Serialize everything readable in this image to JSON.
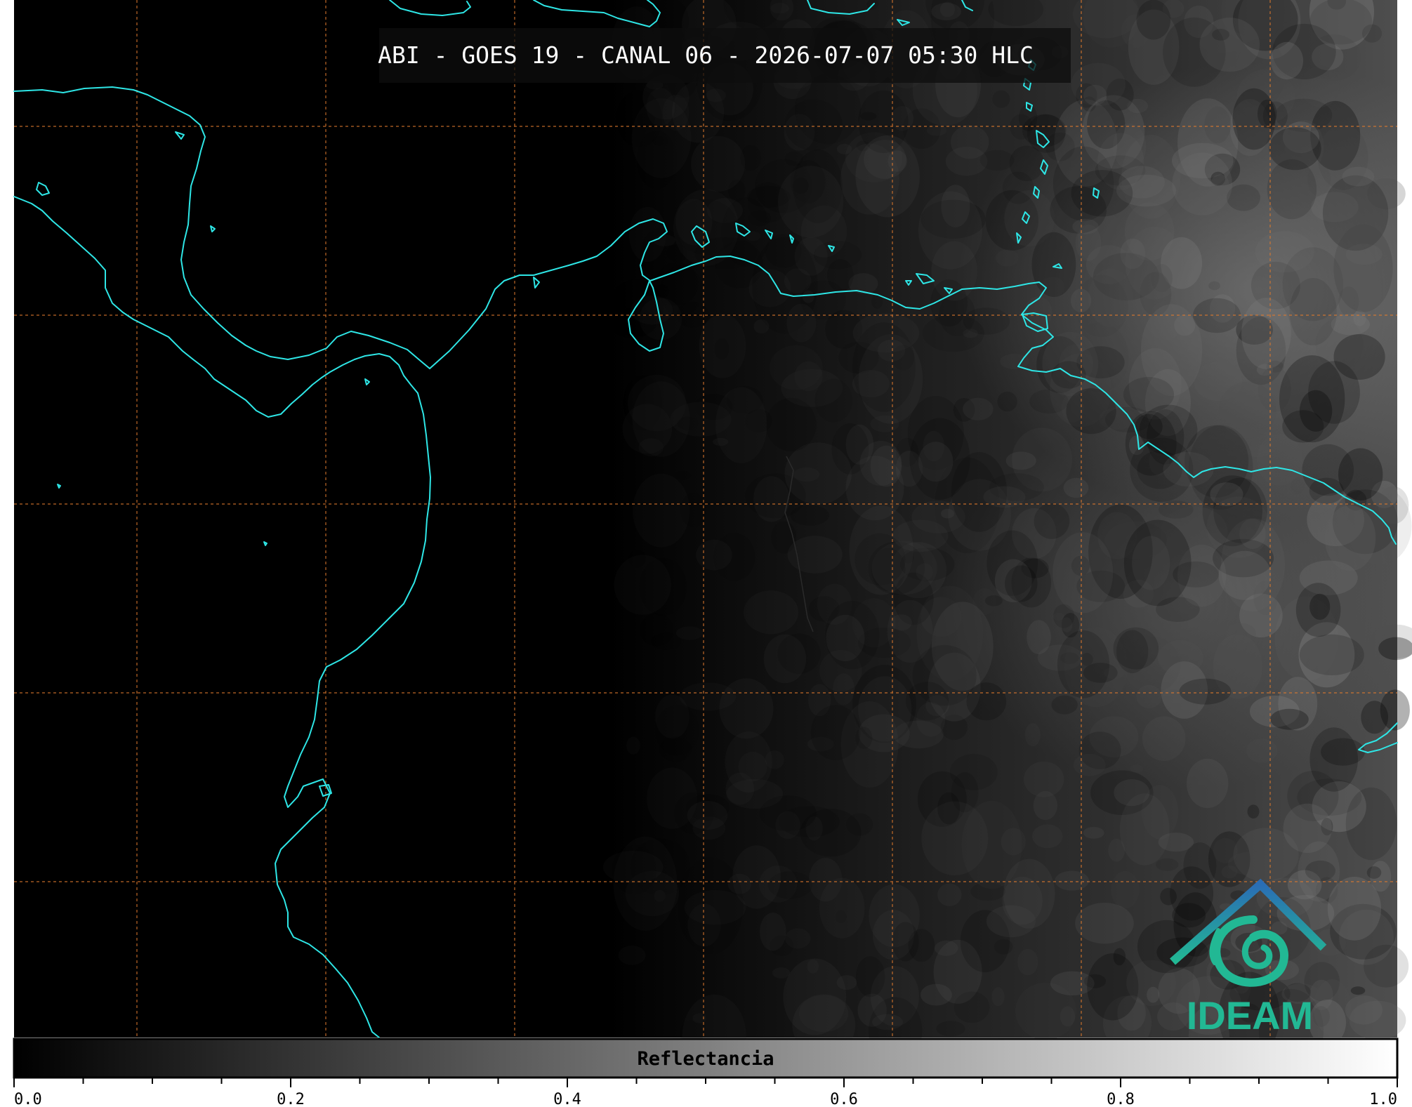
{
  "title": "ABI - GOES 19 - CANAL 06 - 2026-07-07 05:30 HLC",
  "colorbar": {
    "label": "Reflectancia",
    "ticks": [
      "0.0",
      "0.2",
      "0.4",
      "0.6",
      "0.8",
      "1.0"
    ]
  },
  "logo": {
    "text": "IDEAM"
  },
  "colors": {
    "coastline": "#2ee6e6",
    "graticule": "#e07a2e",
    "background": "#000000",
    "logo_blue": "#2a6db5",
    "logo_teal": "#22b894"
  }
}
